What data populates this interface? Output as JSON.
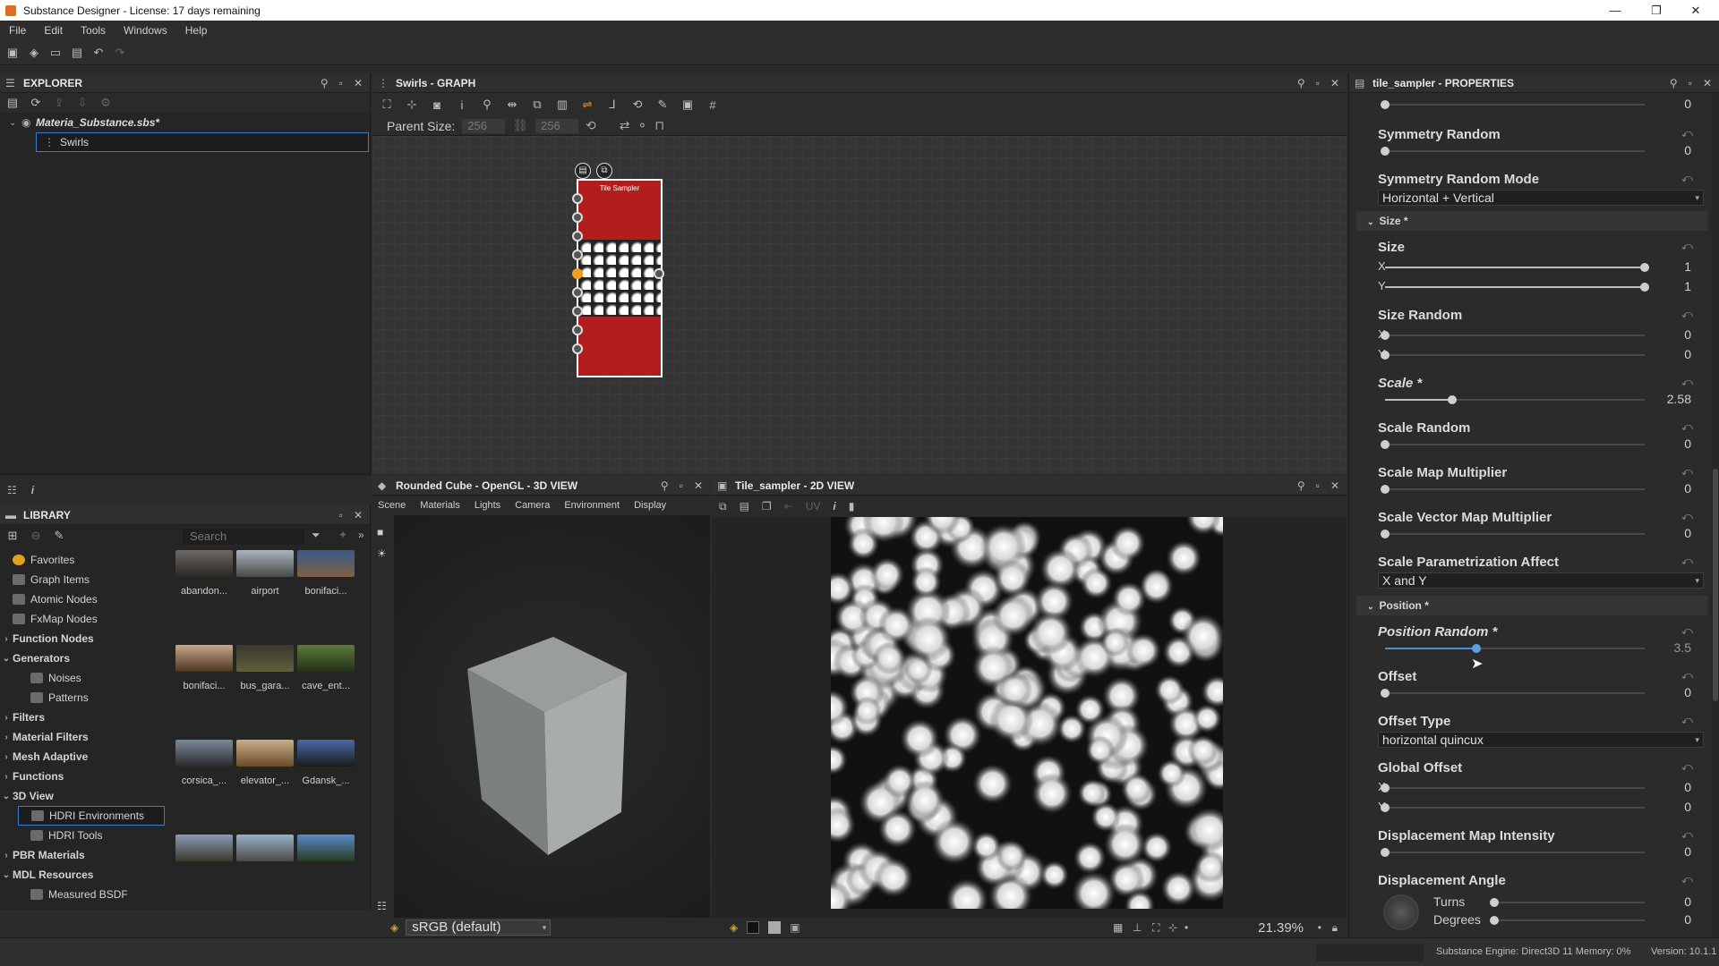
{
  "window": {
    "title": "Substance Designer - License: 17 days remaining"
  },
  "menu": [
    "File",
    "Edit",
    "Tools",
    "Windows",
    "Help"
  ],
  "explorer": {
    "title": "EXPLORER",
    "package": "Materia_Substance.sbs*",
    "graph": "Swirls"
  },
  "library": {
    "title": "LIBRARY",
    "search_placeholder": "Search",
    "tree": [
      {
        "label": "Favorites",
        "bold": false,
        "arrow": ""
      },
      {
        "label": "Graph Items",
        "bold": false,
        "arrow": ""
      },
      {
        "label": "Atomic Nodes",
        "bold": false,
        "arrow": ""
      },
      {
        "label": "FxMap Nodes",
        "bold": false,
        "arrow": ""
      },
      {
        "label": "Function Nodes",
        "bold": true,
        "arrow": "›"
      },
      {
        "label": "Generators",
        "bold": true,
        "arrow": "⌄"
      },
      {
        "label": "Noises",
        "bold": false,
        "arrow": ""
      },
      {
        "label": "Patterns",
        "bold": false,
        "arrow": ""
      },
      {
        "label": "Filters",
        "bold": true,
        "arrow": "›"
      },
      {
        "label": "Material Filters",
        "bold": true,
        "arrow": "›"
      },
      {
        "label": "Mesh Adaptive",
        "bold": true,
        "arrow": "›"
      },
      {
        "label": "Functions",
        "bold": true,
        "arrow": "›"
      },
      {
        "label": "3D View",
        "bold": true,
        "arrow": "⌄"
      },
      {
        "label": "HDRI Environments",
        "bold": false,
        "arrow": ""
      },
      {
        "label": "HDRI Tools",
        "bold": false,
        "arrow": ""
      },
      {
        "label": "PBR Materials",
        "bold": true,
        "arrow": "›"
      },
      {
        "label": "MDL Resources",
        "bold": true,
        "arrow": "⌄"
      },
      {
        "label": "Measured BSDF",
        "bold": false,
        "arrow": ""
      }
    ],
    "thumb_labels": [
      [
        "abandon...",
        "airport",
        "bonifaci..."
      ],
      [
        "bonifaci...",
        "bus_gara...",
        "cave_ent..."
      ],
      [
        "corsica_...",
        "elevator_...",
        "Gdansk_..."
      ]
    ]
  },
  "graph": {
    "title": "Swirls - GRAPH",
    "parent_size_label": "Parent Size:",
    "size_x": "256",
    "size_y": "256",
    "node_title": "Tile Sampler"
  },
  "view3d": {
    "title": "Rounded Cube - OpenGL - 3D VIEW",
    "menus": [
      "Scene",
      "Materials",
      "Lights",
      "Camera",
      "Environment",
      "Display"
    ],
    "colorspace": "sRGB (default)"
  },
  "view2d": {
    "title": "Tile_sampler - 2D VIEW",
    "uv_label": "UV",
    "zoom": "21.39%"
  },
  "properties": {
    "title": "tile_sampler - PROPERTIES",
    "rotation_random": "0",
    "symmetry_random": {
      "label": "Symmetry Random",
      "value": "0"
    },
    "symmetry_random_mode": {
      "label": "Symmetry Random Mode",
      "value": "Horizontal + Vertical"
    },
    "size_group": "Size *",
    "size": {
      "label": "Size",
      "x": "1",
      "y": "1",
      "x_frac": 1.0,
      "y_frac": 1.0
    },
    "size_random": {
      "label": "Size Random",
      "x": "0",
      "y": "0"
    },
    "scale": {
      "label": "Scale *",
      "value": "2.58",
      "frac": 0.258
    },
    "scale_random": {
      "label": "Scale Random",
      "value": "0"
    },
    "scale_map_multiplier": {
      "label": "Scale Map Multiplier",
      "value": "0"
    },
    "scale_vector_map_multiplier": {
      "label": "Scale Vector Map Multiplier",
      "value": "0"
    },
    "scale_param_affect": {
      "label": "Scale Parametrization Affect",
      "value": "X and Y"
    },
    "position_group": "Position *",
    "position_random": {
      "label": "Position Random *",
      "value": "3.5",
      "frac": 0.35
    },
    "offset": {
      "label": "Offset",
      "value": "0"
    },
    "offset_type": {
      "label": "Offset Type",
      "value": "horizontal quincux"
    },
    "global_offset": {
      "label": "Global Offset",
      "x": "0",
      "y": "0"
    },
    "displacement_map_intensity": {
      "label": "Displacement Map Intensity",
      "value": "0"
    },
    "displacement_angle": {
      "label": "Displacement Angle",
      "turns_label": "Turns",
      "degrees_label": "Degrees",
      "turns": "0",
      "degrees": "0"
    },
    "x_label": "X",
    "y_label": "Y"
  },
  "status": {
    "engine": "Substance Engine: Direct3D 11  Memory: 0%",
    "version": "Version: 10.1.1"
  },
  "colors": {
    "node_red": "#b21e1e",
    "selection_blue": "#3a7ad0",
    "slider_blue": "#4a8fd6"
  }
}
